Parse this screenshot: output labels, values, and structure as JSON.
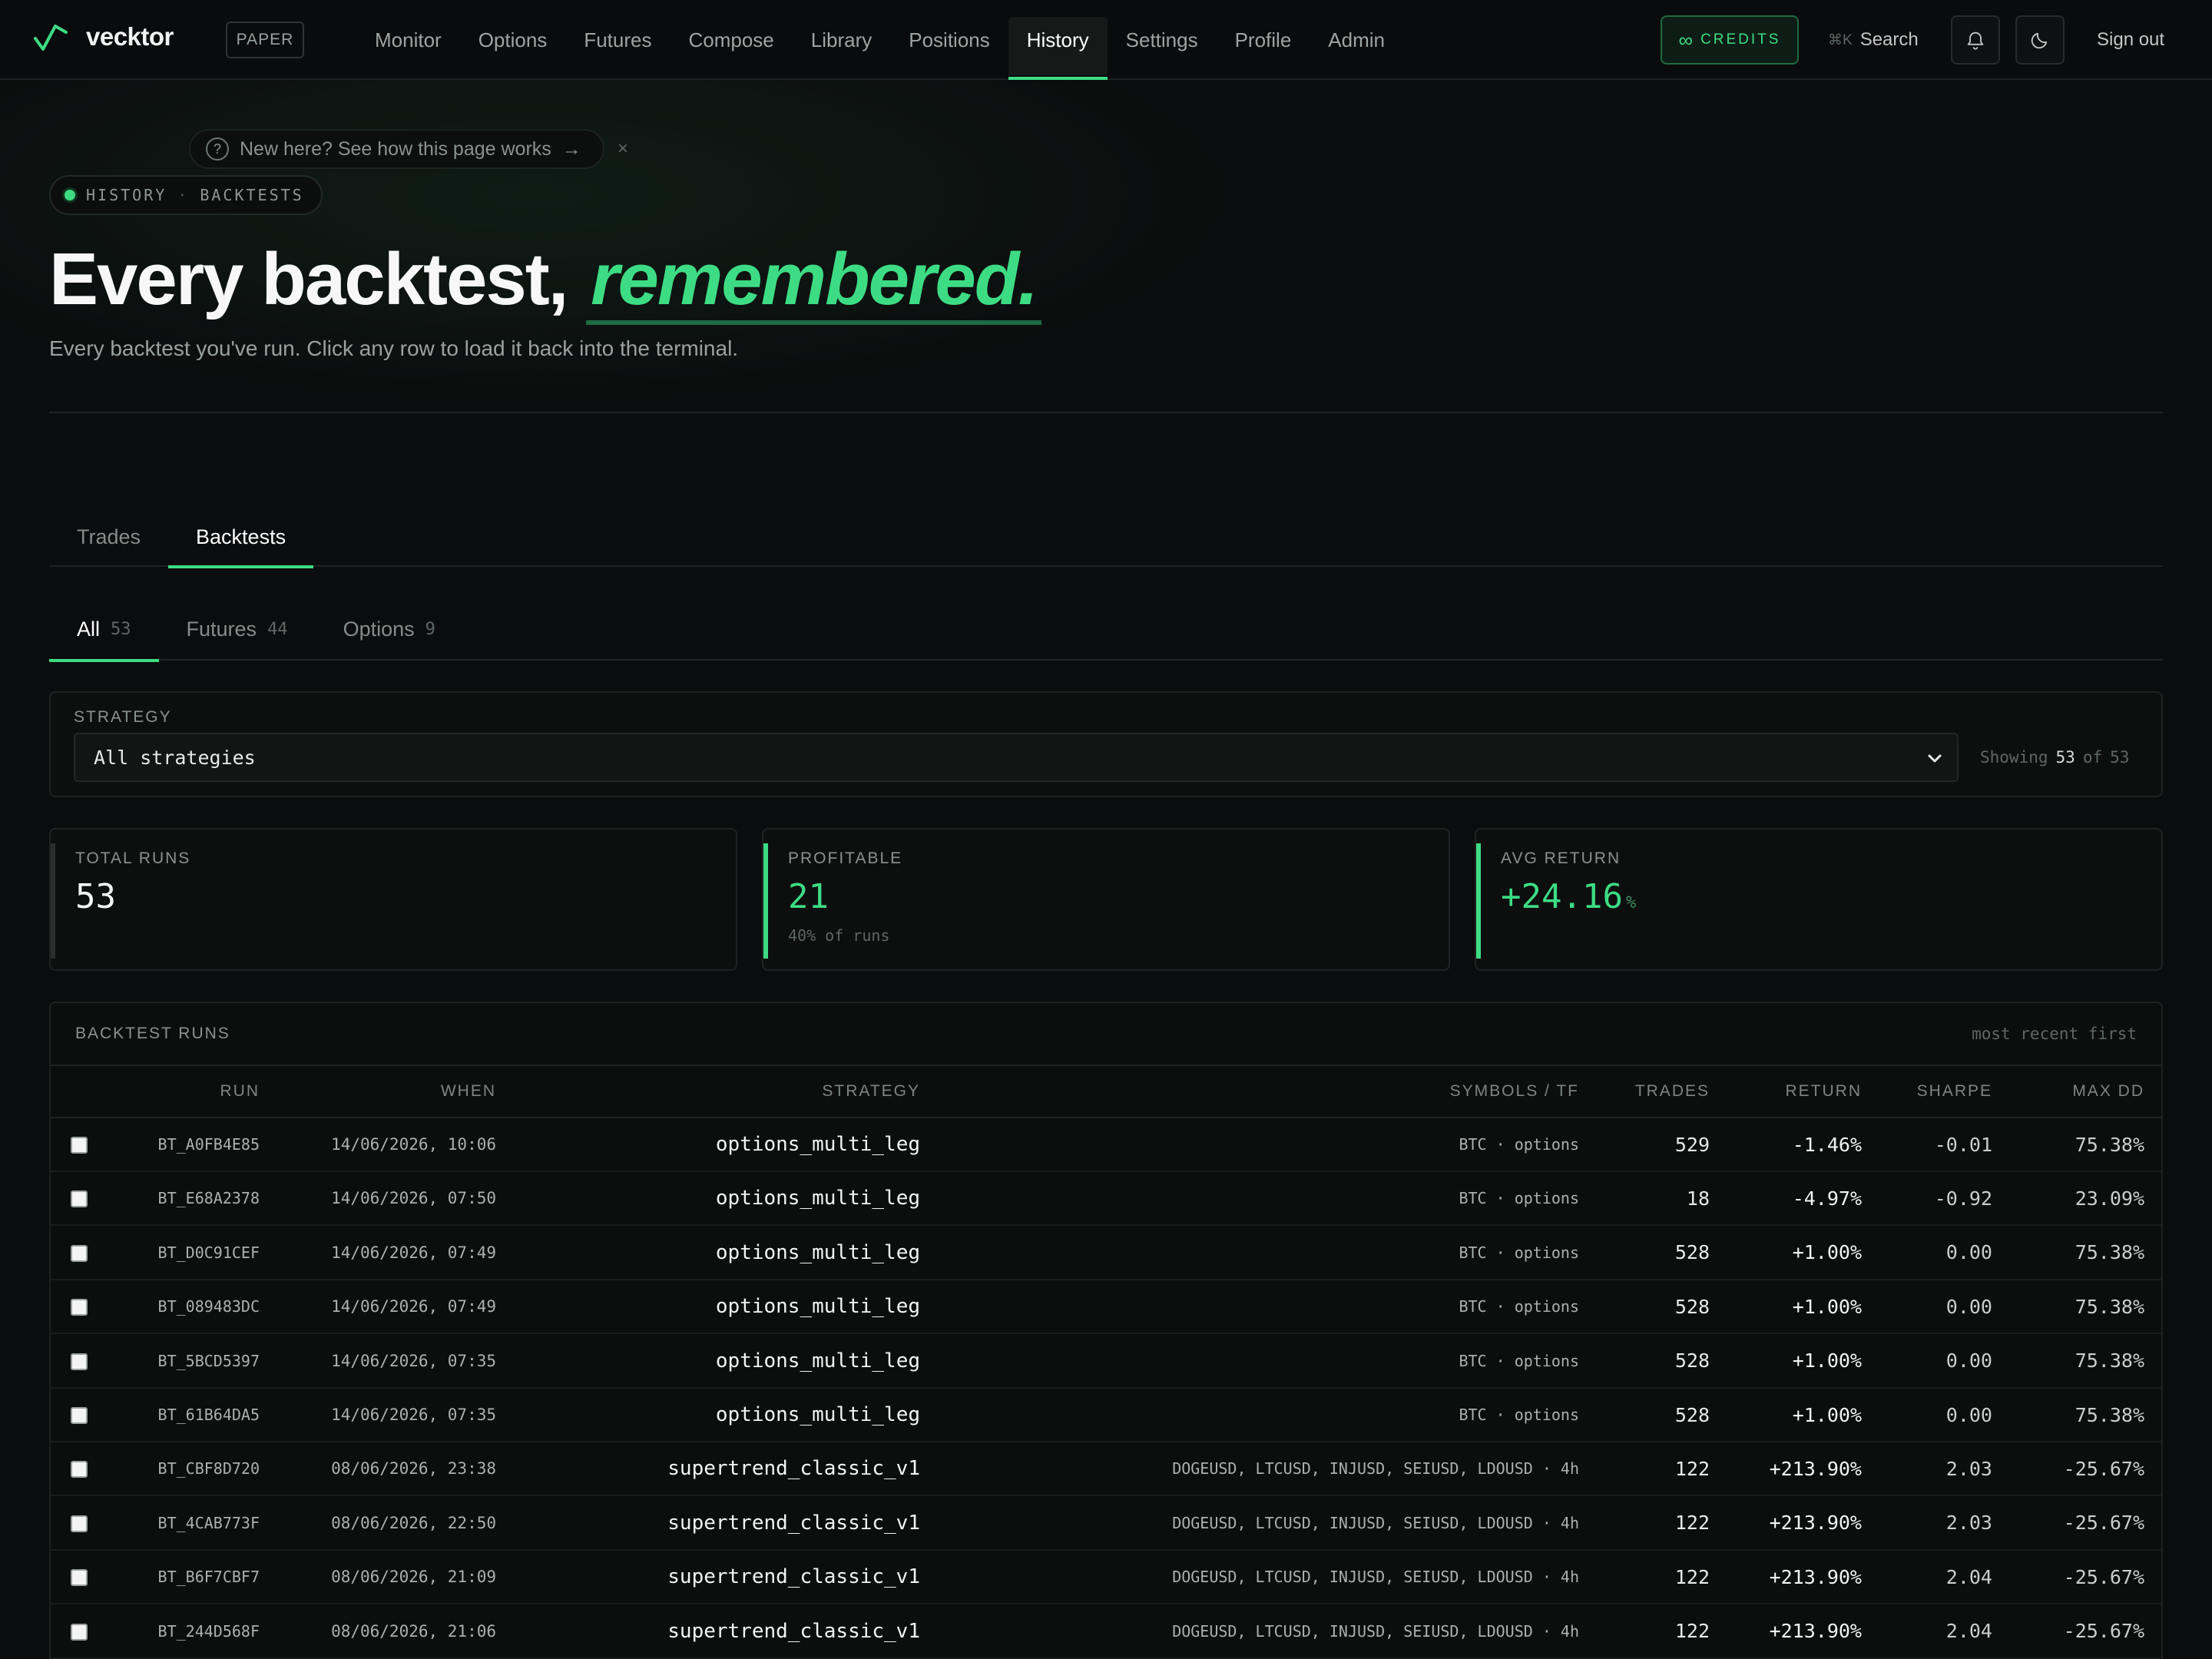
{
  "nav": {
    "brand": "vecktor",
    "mode_badge": "PAPER",
    "links": [
      "Monitor",
      "Options",
      "Futures",
      "Compose",
      "Library",
      "Positions",
      "History",
      "Settings",
      "Profile",
      "Admin"
    ],
    "active": "History",
    "credits_label": "CREDITS",
    "credits_symbol": "∞",
    "search_shortcut": "⌘K",
    "search_label": "Search",
    "sign_out": "Sign out",
    "accent_color": "#3ddc84"
  },
  "hero": {
    "help_tip": "New here? See how this page works",
    "help_arrow": "→",
    "close": "×",
    "breadcrumb": [
      "HISTORY",
      "BACKTESTS"
    ],
    "breadcrumb_sep": "·",
    "title": "Every backtest,",
    "title_accent": "remembered.",
    "subtitle": "Every backtest you've run. Click any row to load it back into the terminal."
  },
  "tabs": [
    "Trades",
    "Backtests"
  ],
  "active_tab": "Backtests",
  "subtabs": [
    {
      "label": "All",
      "count": "53"
    },
    {
      "label": "Futures",
      "count": "44"
    },
    {
      "label": "Options",
      "count": "9"
    }
  ],
  "active_subtab": "All",
  "filter": {
    "label": "STRATEGY",
    "value": "All strategies",
    "showing_prefix": "Showing",
    "showing_count": "53",
    "showing_of": "of",
    "showing_total": "53"
  },
  "stats": [
    {
      "label": "TOTAL RUNS",
      "value": "53",
      "unit": "",
      "sub": ""
    },
    {
      "label": "PROFITABLE",
      "value": "21",
      "unit": "",
      "sub": "40% of runs"
    },
    {
      "label": "AVG RETURN",
      "value": "+24.16",
      "unit": "%",
      "sub": ""
    }
  ],
  "table": {
    "title": "BACKTEST RUNS",
    "note": "most recent first",
    "columns": [
      "RUN",
      "WHEN",
      "STRATEGY",
      "SYMBOLS / TF",
      "TRADES",
      "RETURN",
      "SHARPE",
      "MAX DD"
    ],
    "rows": [
      {
        "run": "BT_A0FB4E85",
        "when": "14/06/2026, 10:06",
        "strategy": "options_multi_leg",
        "symbols": "BTC · options",
        "trades": "529",
        "ret": "-1.46%",
        "sharpe": "-0.01",
        "dd": "75.38%"
      },
      {
        "run": "BT_E68A2378",
        "when": "14/06/2026, 07:50",
        "strategy": "options_multi_leg",
        "symbols": "BTC · options",
        "trades": "18",
        "ret": "-4.97%",
        "sharpe": "-0.92",
        "dd": "23.09%"
      },
      {
        "run": "BT_D0C91CEF",
        "when": "14/06/2026, 07:49",
        "strategy": "options_multi_leg",
        "symbols": "BTC · options",
        "trades": "528",
        "ret": "+1.00%",
        "sharpe": "0.00",
        "dd": "75.38%"
      },
      {
        "run": "BT_089483DC",
        "when": "14/06/2026, 07:49",
        "strategy": "options_multi_leg",
        "symbols": "BTC · options",
        "trades": "528",
        "ret": "+1.00%",
        "sharpe": "0.00",
        "dd": "75.38%"
      },
      {
        "run": "BT_5BCD5397",
        "when": "14/06/2026, 07:35",
        "strategy": "options_multi_leg",
        "symbols": "BTC · options",
        "trades": "528",
        "ret": "+1.00%",
        "sharpe": "0.00",
        "dd": "75.38%"
      },
      {
        "run": "BT_61B64DA5",
        "when": "14/06/2026, 07:35",
        "strategy": "options_multi_leg",
        "symbols": "BTC · options",
        "trades": "528",
        "ret": "+1.00%",
        "sharpe": "0.00",
        "dd": "75.38%"
      },
      {
        "run": "BT_CBF8D720",
        "when": "08/06/2026, 23:38",
        "strategy": "supertrend_classic_v1",
        "symbols": "DOGEUSD, LTCUSD, INJUSD, SEIUSD, LDOUSD · 4h",
        "trades": "122",
        "ret": "+213.90%",
        "sharpe": "2.03",
        "dd": "-25.67%"
      },
      {
        "run": "BT_4CAB773F",
        "when": "08/06/2026, 22:50",
        "strategy": "supertrend_classic_v1",
        "symbols": "DOGEUSD, LTCUSD, INJUSD, SEIUSD, LDOUSD · 4h",
        "trades": "122",
        "ret": "+213.90%",
        "sharpe": "2.03",
        "dd": "-25.67%"
      },
      {
        "run": "BT_B6F7CBF7",
        "when": "08/06/2026, 21:09",
        "strategy": "supertrend_classic_v1",
        "symbols": "DOGEUSD, LTCUSD, INJUSD, SEIUSD, LDOUSD · 4h",
        "trades": "122",
        "ret": "+213.90%",
        "sharpe": "2.04",
        "dd": "-25.67%"
      },
      {
        "run": "BT_244D568F",
        "when": "08/06/2026, 21:06",
        "strategy": "supertrend_classic_v1",
        "symbols": "DOGEUSD, LTCUSD, INJUSD, SEIUSD, LDOUSD · 4h",
        "trades": "122",
        "ret": "+213.90%",
        "sharpe": "2.04",
        "dd": "-25.67%"
      }
    ]
  }
}
